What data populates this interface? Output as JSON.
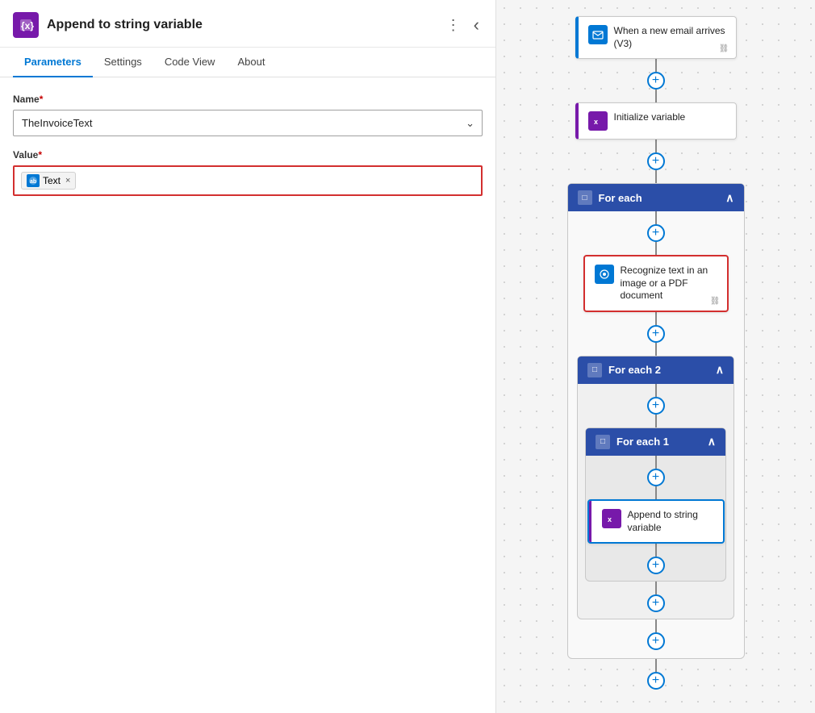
{
  "panel": {
    "icon_alt": "append-string-icon",
    "title": "Append to string variable",
    "tabs": [
      {
        "id": "parameters",
        "label": "Parameters",
        "active": true
      },
      {
        "id": "settings",
        "label": "Settings",
        "active": false
      },
      {
        "id": "code-view",
        "label": "Code View",
        "active": false
      },
      {
        "id": "about",
        "label": "About",
        "active": false
      }
    ],
    "name_label": "Name",
    "name_required": "*",
    "name_value": "TheInvoiceText",
    "value_label": "Value",
    "value_required": "*",
    "token_label": "Text",
    "token_close": "×"
  },
  "flow": {
    "email_node": {
      "label": "When a new email arrives (V3)"
    },
    "init_node": {
      "label": "Initialize variable"
    },
    "foreach_node": {
      "label": "For each"
    },
    "recognize_node": {
      "label": "Recognize text in an image or a PDF document"
    },
    "foreach2_node": {
      "label": "For each 2"
    },
    "foreach1_node": {
      "label": "For each 1"
    },
    "append_node": {
      "label": "Append to string variable"
    }
  },
  "icons": {
    "dots_vertical": "⋮",
    "chevron_left": "‹",
    "chevron_down": "∨",
    "plus": "+",
    "collapse": "∧",
    "link": "🔗",
    "foreach_icon": "□"
  }
}
